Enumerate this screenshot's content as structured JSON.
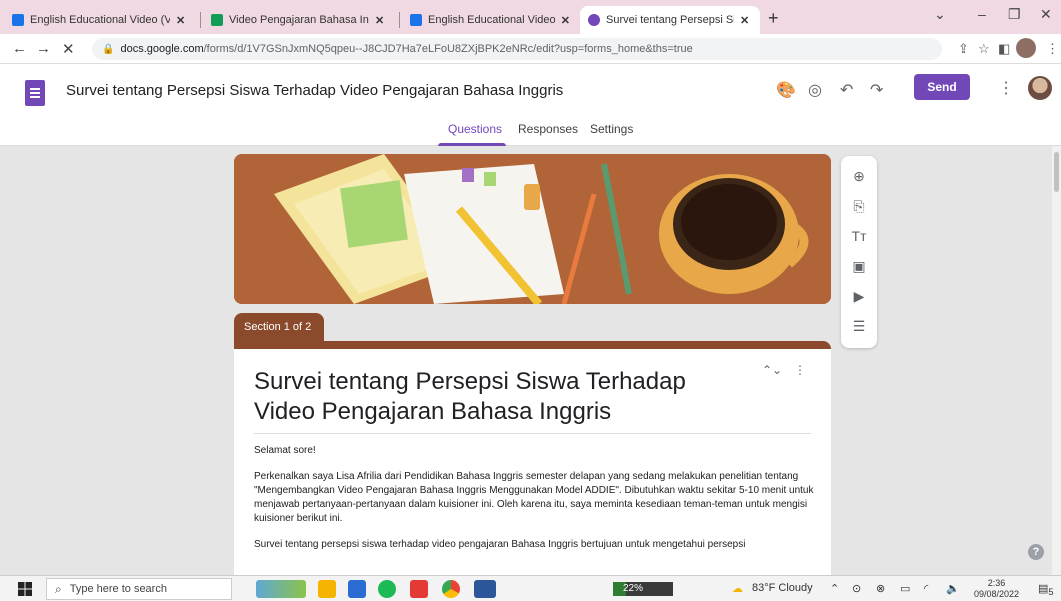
{
  "browser": {
    "tabs": [
      {
        "title": "English Educational Video (Video",
        "favicon": "blue",
        "active": false
      },
      {
        "title": "Video Pengajaran Bahasa Inggris",
        "favicon": "green",
        "active": false
      },
      {
        "title": "English Educational Videos",
        "favicon": "blue",
        "active": false
      },
      {
        "title": "Survei tentang Persepsi Siswa Te",
        "favicon": "forms",
        "active": true
      }
    ],
    "url_host": "docs.google.com",
    "url_path": "/forms/d/1V7GSnJxmNQ5qpeu--J8CJD7Ha7eLFoU8ZXjBPK2eNRc/edit?usp=forms_home&ths=true"
  },
  "forms": {
    "document_title": "Survei tentang Persepsi Siswa Terhadap Video Pengajaran Bahasa Inggris",
    "send_label": "Send",
    "tabs": [
      "Questions",
      "Responses",
      "Settings"
    ],
    "accent_color": "#7248b9"
  },
  "section_label": "Section 1 of 2",
  "card": {
    "title": "Survei tentang Persepsi Siswa Terhadap Video Pengajaran Bahasa Inggris",
    "paragraphs": [
      "Selamat sore!",
      "Perkenalkan saya Lisa Afrilia dari Pendidikan Bahasa Inggris semester delapan yang sedang melakukan penelitian tentang \"Mengembangkan Video Pengajaran Bahasa Inggris Menggunakan Model ADDIE\". Dibutuhkan waktu sekitar 5-10 menit untuk menjawab pertanyaan-pertanyaan dalam kuisioner ini. Oleh karena itu, saya meminta kesediaan teman-teman untuk mengisi kuisioner berikut ini.",
      "Survei tentang persepsi siswa terhadap video pengajaran Bahasa Inggris bertujuan untuk mengetahui persepsi"
    ]
  },
  "sidetools": [
    "add-question-icon",
    "import-questions-icon",
    "add-title-icon",
    "add-image-icon",
    "add-video-icon",
    "add-section-icon"
  ],
  "taskbar": {
    "search_placeholder": "Type here to search",
    "battery_label": "22%",
    "battery_level": 0.22,
    "weather": "83°F  Cloudy",
    "time": "2:36",
    "date": "09/08/2022",
    "notification_count": "5"
  }
}
